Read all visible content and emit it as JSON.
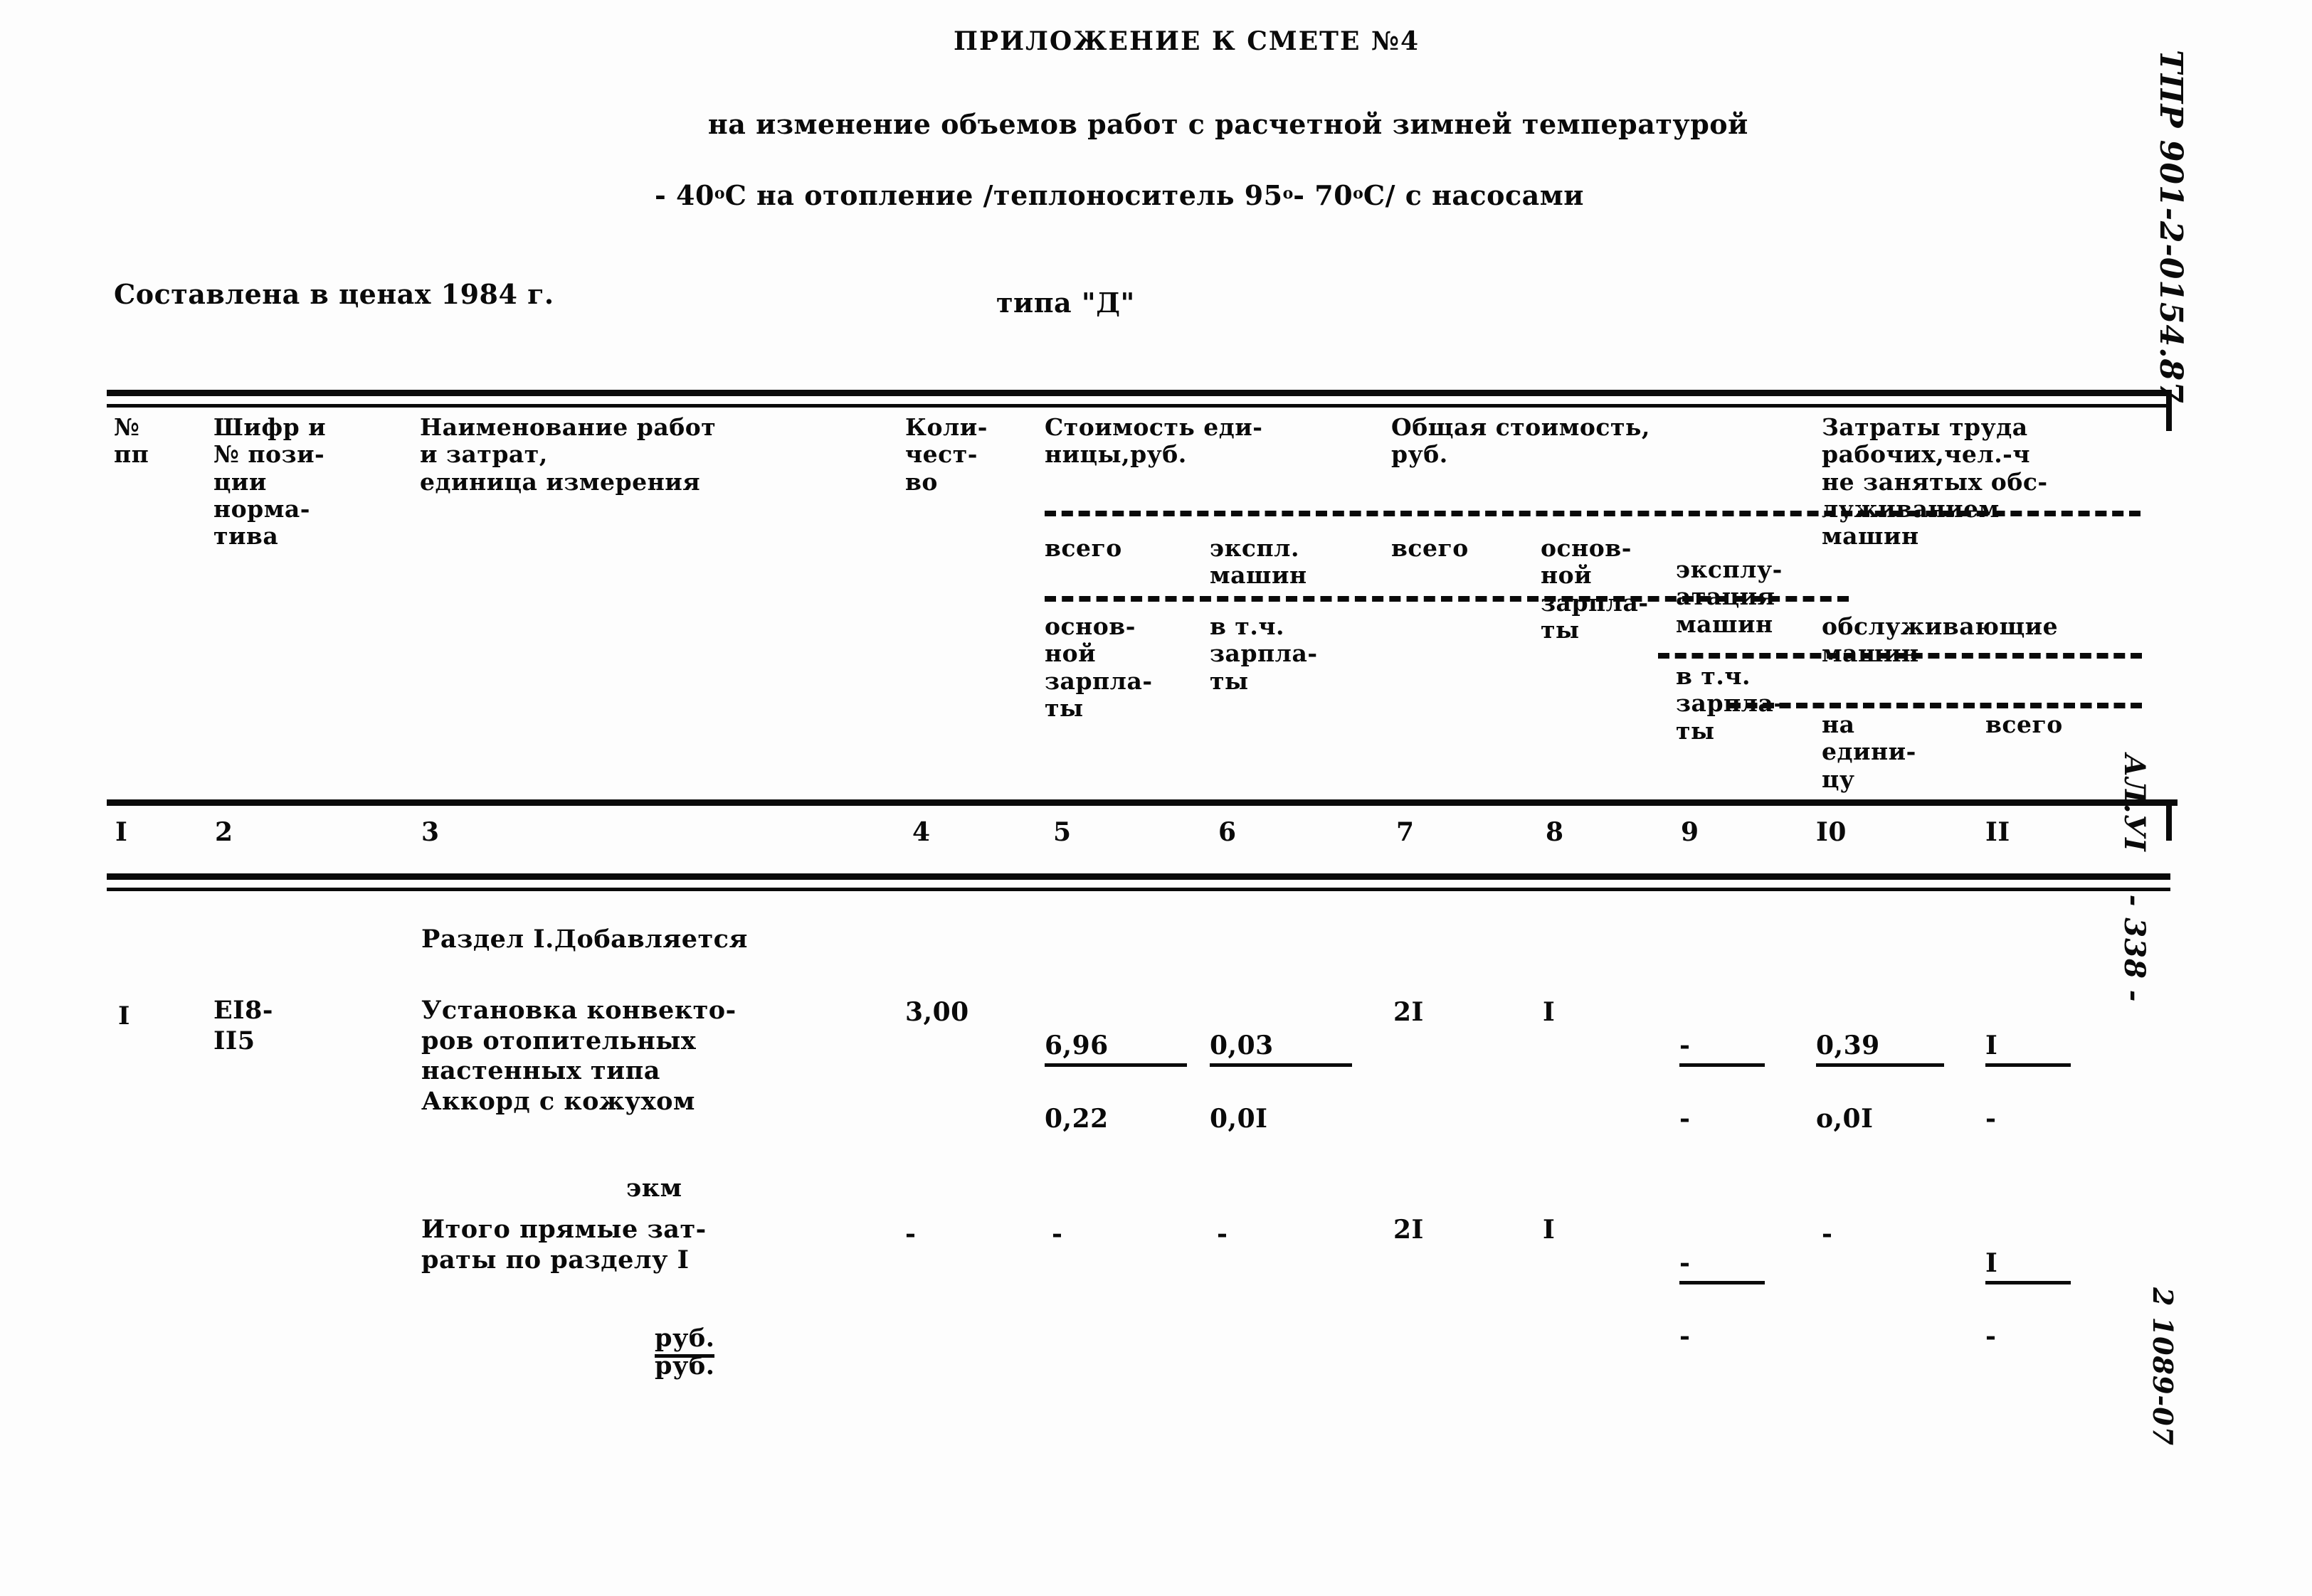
{
  "document": {
    "title": "ПРИЛОЖЕНИЕ К СМЕТЕ №4",
    "subtitle_line1": "на изменение объемов работ с расчетной зимней температурой",
    "subtitle_line2_a": "- 40",
    "subtitle_line2_sup1": "o",
    "subtitle_line2_b": "С на отопление /теплоноситель 95",
    "subtitle_line2_sup2": "o",
    "subtitle_line2_c": "- 70",
    "subtitle_line2_sup3": "o",
    "subtitle_line2_d": "С/ с насосами",
    "subtitle_line3": "типа \"Д\"",
    "prices_note": "Составлена в ценах 1984 г."
  },
  "side_matter": {
    "code": "ТПР 901-2-0154.87",
    "sheet": "АЛ.УI",
    "page": "- 338 -",
    "order": "2 1089-07"
  },
  "table": {
    "headers": {
      "col1": "№\nпп",
      "col2": "Шифр и\n№ пози-\nции\nнорма-\nтива",
      "col3": "Наименование работ\nи затрат,\nединица измерения",
      "col4": "Коли-\nчест-\nво",
      "group_unit_cost": "Стоимость еди-\nницы,руб.",
      "col5_a": "всего",
      "col5_b": "основ-\nной\nзарпла-\nты",
      "col6_a": "экспл.\nмашин",
      "col6_b": "в т.ч.\nзарпла-\nты",
      "group_total_cost": "Общая стоимость,\nруб.",
      "col7": "всего",
      "col8": "основ-\nной\nзарпла-\nты",
      "col9_a": "эксплу-\nатация\nмашин",
      "col9_b": "в т.ч.\nзарпла-\nты",
      "group_labor": "Затраты труда\nрабочих,чел.-ч\nне занятых обс-\nлуживанием\nмашин",
      "group_labor_b": "обслуживающие\nмашин",
      "col10": "на\nедини-\nцу",
      "col11": "всего"
    },
    "column_numbers": [
      "I",
      "2",
      "3",
      "4",
      "5",
      "6",
      "7",
      "8",
      "9",
      "I0",
      "II"
    ],
    "section_heading": "Раздел I.Добавляется",
    "rows": [
      {
        "col1": "I",
        "col2": "EI8-\nII5",
        "col3": "Установка конвекто-\nров отопительных\nнастенных типа\nАккорд с кожухом",
        "col3_unit": "экм",
        "col4": "3,00",
        "col5_top": "6,96",
        "col5_bot": "0,22",
        "col6_top": "0,03",
        "col6_bot": "0,0I",
        "col7": "2I",
        "col8": "I",
        "col9_top": "-",
        "col9_bot": "-",
        "col10_top": "0,39",
        "col10_bot": "о,0I",
        "col11_top": "I",
        "col11_bot": "-"
      },
      {
        "col1": "",
        "col2": "",
        "col3": "Итого прямые зат-\nраты по разделу I",
        "col3_unit_a": "руб.",
        "col3_unit_b": "руб.",
        "col4": "-",
        "col5_top": "-",
        "col5_bot": "",
        "col6_top": "-",
        "col6_bot": "",
        "col7": "2I",
        "col8": "I",
        "col9_top": "-",
        "col9_bot": "-",
        "col10_top": "-",
        "col10_bot": "",
        "col11_top": "I",
        "col11_bot": "-"
      }
    ]
  }
}
